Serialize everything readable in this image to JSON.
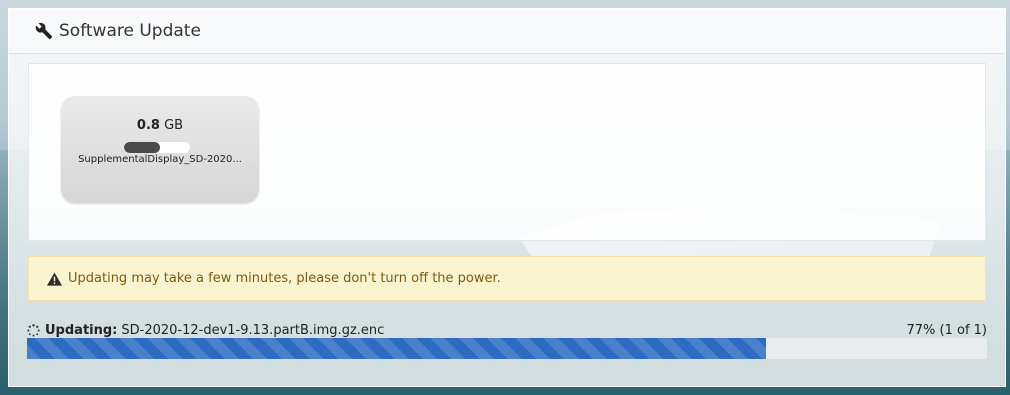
{
  "header": {
    "title": "Software Update",
    "icon": "wrench-icon"
  },
  "file_card": {
    "size_value": "0.8",
    "size_unit": "GB",
    "name": "SupplementalDisplay_SD-2020...",
    "progress_fraction": 0.55
  },
  "alert": {
    "icon": "warning-icon",
    "text": "Updating may take a few minutes, please don't turn off the power."
  },
  "status": {
    "icon": "spinner-icon",
    "label": "Updating:",
    "filename": "SD-2020-12-dev1-9.13.partB.img.gz.enc",
    "percent_text": "77% (1 of 1)",
    "progress_percent": 77
  },
  "colors": {
    "progress_fill": "#2d6bc1",
    "alert_bg": "#fcf3cf",
    "alert_text": "#7a5c12"
  }
}
